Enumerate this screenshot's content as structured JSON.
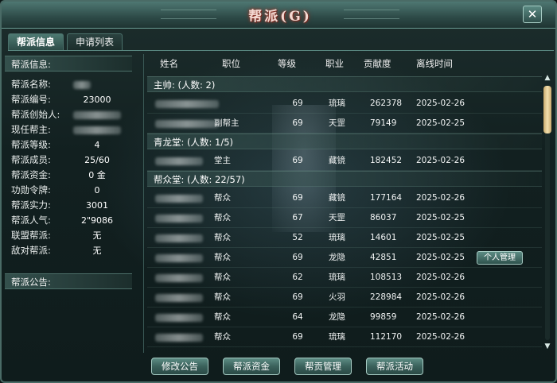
{
  "window": {
    "title": "帮派(G)",
    "close_label": "✕"
  },
  "tabs": {
    "info": "帮派信息",
    "applications": "申请列表"
  },
  "guild_info": {
    "heading": "帮派信息:",
    "rows": [
      {
        "label": "帮派名称:",
        "value": ""
      },
      {
        "label": "帮派编号:",
        "value": "23000"
      },
      {
        "label": "帮派创始人:",
        "value": ""
      },
      {
        "label": "现任帮主:",
        "value": ""
      },
      {
        "label": "帮派等级:",
        "value": "4"
      },
      {
        "label": "帮派成员:",
        "value": "25/60"
      },
      {
        "label": "帮派资金:",
        "value": "0 金"
      },
      {
        "label": "功勋令牌:",
        "value": "0"
      },
      {
        "label": "帮派实力:",
        "value": "3001"
      },
      {
        "label": "帮派人气:",
        "value": "2\"9086"
      },
      {
        "label": "联盟帮派:",
        "value": "无"
      },
      {
        "label": "敌对帮派:",
        "value": "无"
      }
    ],
    "notice_heading": "帮派公告:"
  },
  "members": {
    "columns": {
      "name": "姓名",
      "position": "职位",
      "level": "等级",
      "job": "职业",
      "contribution": "贡献度",
      "offline_time": "离线时间"
    },
    "groups": [
      {
        "label": "主帅: (人数: 2)",
        "rows": [
          {
            "name": "",
            "position": "",
            "level": "69",
            "job": "琉璃",
            "contribution": "262378",
            "offline_time": "2025-02-26"
          },
          {
            "name": "",
            "position": "副帮主",
            "level": "69",
            "job": "天罡",
            "contribution": "79149",
            "offline_time": "2025-02-25"
          }
        ]
      },
      {
        "label": "青龙堂: (人数: 1/5)",
        "rows": [
          {
            "name": "",
            "position": "堂主",
            "level": "69",
            "job": "藏镜",
            "contribution": "182452",
            "offline_time": "2025-02-26"
          }
        ]
      },
      {
        "label": "帮众堂: (人数: 22/57)",
        "rows": [
          {
            "name": "",
            "position": "帮众",
            "level": "69",
            "job": "藏镜",
            "contribution": "177164",
            "offline_time": "2025-02-26"
          },
          {
            "name": "",
            "position": "帮众",
            "level": "67",
            "job": "天罡",
            "contribution": "86037",
            "offline_time": "2025-02-25"
          },
          {
            "name": "",
            "position": "帮众",
            "level": "52",
            "job": "琉璃",
            "contribution": "14601",
            "offline_time": "2025-02-25"
          },
          {
            "name": "",
            "position": "帮众",
            "level": "69",
            "job": "龙隐",
            "contribution": "42851",
            "offline_time": "2025-02-25"
          },
          {
            "name": "",
            "position": "帮众",
            "level": "62",
            "job": "琉璃",
            "contribution": "108513",
            "offline_time": "2025-02-26"
          },
          {
            "name": "",
            "position": "帮众",
            "level": "69",
            "job": "火羽",
            "contribution": "228984",
            "offline_time": "2025-02-26"
          },
          {
            "name": "",
            "position": "帮众",
            "level": "64",
            "job": "龙隐",
            "contribution": "99859",
            "offline_time": "2025-02-26"
          },
          {
            "name": "",
            "position": "帮众",
            "level": "69",
            "job": "琉璃",
            "contribution": "112170",
            "offline_time": "2025-02-26"
          }
        ]
      }
    ],
    "manage_label": "个人管理"
  },
  "actions": {
    "edit_notice": "修改公告",
    "guild_funds": "帮派资金",
    "contribution_manage": "帮贡管理",
    "guild_activity": "帮派活动"
  },
  "colors": {
    "accent": "#5d8d85",
    "thumb": "#e6cf96",
    "title_glow": "#a04a3c"
  }
}
